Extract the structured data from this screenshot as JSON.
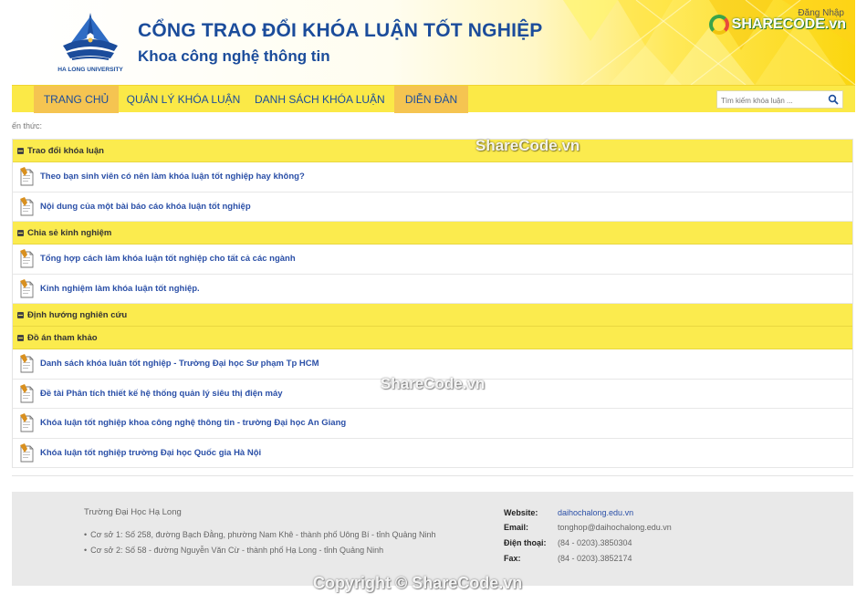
{
  "header": {
    "logo_caption": "HA LONG UNIVERSITY",
    "title": "CỔNG TRAO ĐỔI KHÓA LUẬN TỐT NGHIỆP",
    "subtitle": "Khoa công nghệ thông tin",
    "login_label": "Đăng Nhập",
    "badge_text": "SHARECODE.vn"
  },
  "nav": {
    "items": [
      {
        "label": "TRANG CHỦ",
        "active": true
      },
      {
        "label": "QUẢN LÝ KHÓA LUẬN",
        "active": false
      },
      {
        "label": "DANH SÁCH KHÓA LUẬN",
        "active": false
      },
      {
        "label": "DIỄN ĐÀN",
        "active": true
      }
    ],
    "search_placeholder": "Tìm kiếm khóa luận ..."
  },
  "breadcrumb": "ến thức:",
  "forum": {
    "categories": [
      {
        "name": "Trao đổi khóa luận",
        "topics": [
          "Theo bạn sinh viên có nên làm khóa luận tốt nghiệp hay không?",
          "Nội dung của một bài báo cáo khóa luận tốt nghiệp"
        ]
      },
      {
        "name": "Chia sẻ kinh nghiệm",
        "topics": [
          "Tổng hợp cách làm khóa luận tốt nghiệp cho tất cả các ngành",
          "Kinh nghiệm làm khóa luận tốt nghiệp."
        ]
      },
      {
        "name": "Định hướng nghiên cứu",
        "topics": []
      },
      {
        "name": "Đồ án tham khảo",
        "topics": [
          "Danh sách khóa luân tốt nghiệp - Trường Đại học Sư phạm Tp HCM",
          "Đề tài Phân tích thiết kế hệ thống quản lý siêu thị điện máy",
          "Khóa luận tốt nghiệp khoa công nghệ thông tin - trường Đại học An Giang",
          "Khóa luận tốt nghiệp trường Đại học Quốc gia Hà Nội"
        ]
      }
    ]
  },
  "footer": {
    "school_name": "Trường Đại Học Hạ Long",
    "addresses": [
      "Cơ sở 1: Số 258, đường Bạch Đằng, phường Nam Khê - thành phố Uông Bí - tỉnh Quảng Ninh",
      "Cơ sở 2: Số 58 - đường Nguyễn Văn Cừ - thành phố Hạ Long - tỉnh Quảng Ninh"
    ],
    "website_label": "Website:",
    "website": "daihochalong.edu.vn",
    "email_label": "Email:",
    "email": "tonghop@daihochalong.edu.vn",
    "phone_label": "Điện thoại:",
    "phone": "(84 - 0203).3850304",
    "fax_label": "Fax:",
    "fax": "(84 - 0203).3852174"
  },
  "watermarks": {
    "top": "ShareCode.vn",
    "middle": "ShareCode.vn",
    "bottom": "Copyright © ShareCode.vn"
  },
  "colors": {
    "nav_bg": "#fbe947",
    "nav_active": "#f5c451",
    "category_bg": "#fbeb4e",
    "link": "#2a4fa7",
    "title": "#1b4c9b"
  }
}
